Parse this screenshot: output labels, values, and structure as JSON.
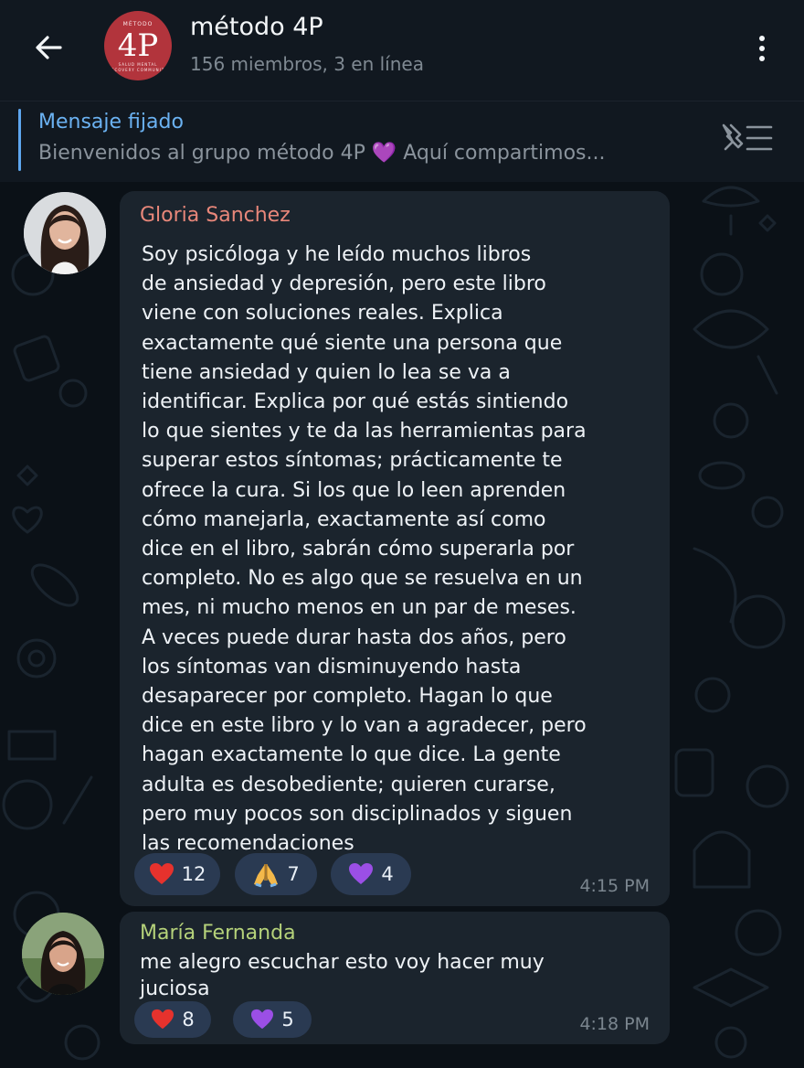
{
  "header": {
    "title": "método 4P",
    "subtitle": "156 miembros, 3 en línea",
    "avatar_text": "4P",
    "avatar_top": "MÉTODO",
    "avatar_bottom": "SALUD MENTAL",
    "avatar_bottom2": "RECOVERY COMMUNITY"
  },
  "pinned": {
    "title": "Mensaje fijado",
    "text": "Bienvenidos al grupo método 4P 💜 Aquí compartimos..."
  },
  "messages": [
    {
      "sender": "Gloria Sanchez",
      "sender_color": "#e8877a",
      "text": "Soy psicóloga y he leído muchos libros\nde ansiedad y depresión, pero este libro\nviene con soluciones reales. Explica\nexactamente qué siente una persona que\ntiene ansiedad y quien lo lea se va a\nidentificar. Explica por qué estás sintiendo\nlo que sientes y te da las herramientas para\nsuperar estos síntomas; prácticamente te\nofrece la cura. Si los que lo leen aprenden\ncómo manejarla, exactamente así como\ndice en el libro, sabrán cómo superarla por\ncompleto. No es algo que se resuelva en un\nmes, ni mucho menos en un par de meses.\nA veces puede durar hasta dos años, pero\nlos síntomas van disminuyendo hasta\ndesaparecer por completo. Hagan lo que\ndice en este libro y lo van a agradecer, pero\nhagan exactamente lo que dice. La gente\nadulta es desobediente; quieren curarse,\npero muy pocos son disciplinados y siguen\nlas recomendaciones",
      "time": "4:15 PM",
      "reactions": [
        {
          "emoji": "heart-icon",
          "count": "12"
        },
        {
          "emoji": "praying-hands-icon",
          "count": "7"
        },
        {
          "emoji": "purple-heart-icon",
          "count": "4"
        }
      ]
    },
    {
      "sender": "María Fernanda",
      "sender_color": "#b5d27a",
      "text": "me alegro escuchar esto voy hacer muy\njuciosa",
      "time": "4:18 PM",
      "reactions": [
        {
          "emoji": "heart-icon",
          "count": "8"
        },
        {
          "emoji": "purple-heart-icon",
          "count": "5"
        }
      ]
    }
  ],
  "colors": {
    "background": "#0b1117",
    "bubble": "#1b242d",
    "accent": "#6bb2f2",
    "reaction_bg": "#2a3a52"
  }
}
